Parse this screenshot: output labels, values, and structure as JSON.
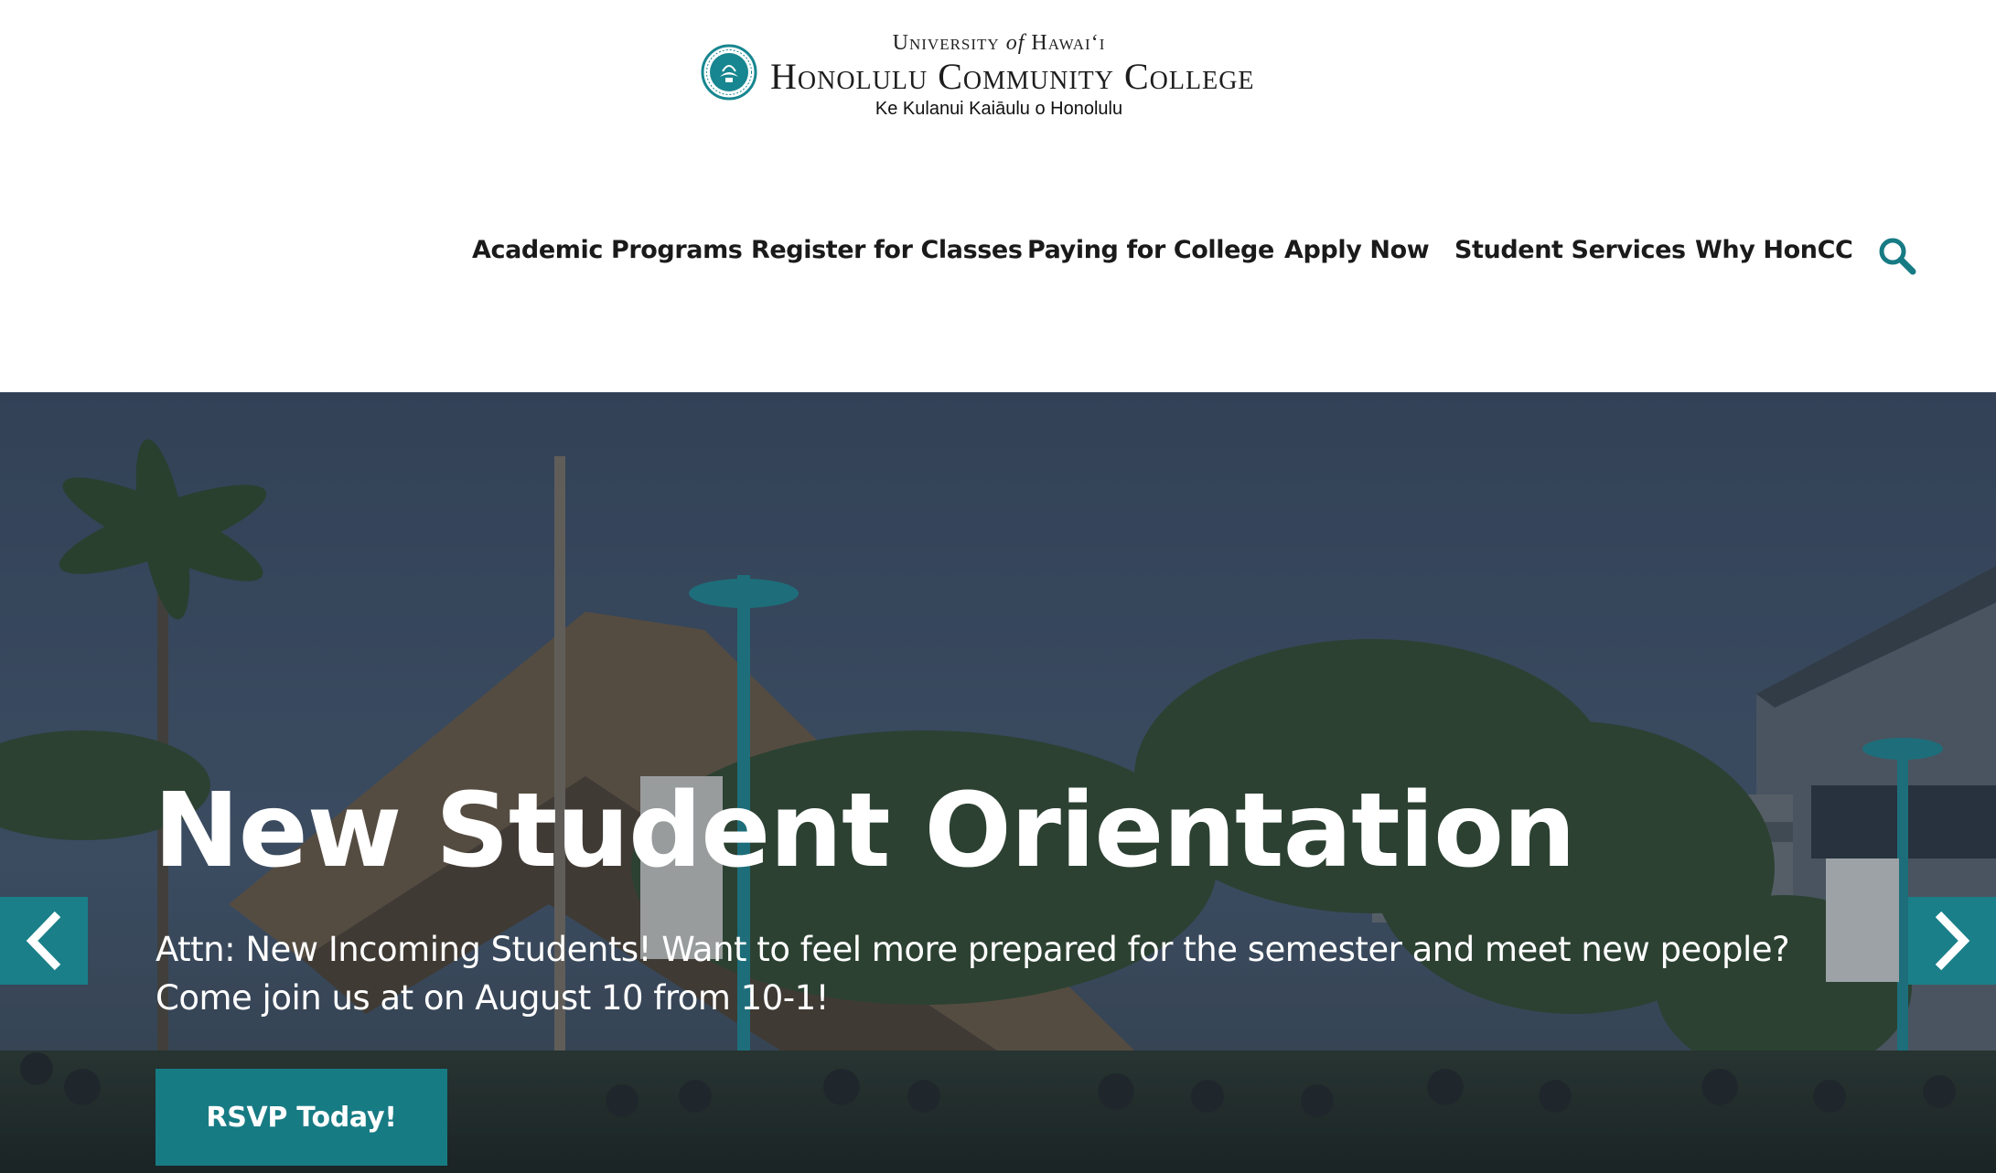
{
  "header": {
    "logo": {
      "line1_part1": "University",
      "line1_part2": "of",
      "line1_part3": "Hawai‘i",
      "line2": "Honolulu Community College",
      "line3": "Ke Kulanui Kaiāulu o Honolulu"
    },
    "nav": [
      {
        "label": "Academic Programs"
      },
      {
        "label": "Register for Classes"
      },
      {
        "label": "Paying for College"
      },
      {
        "label": "Apply Now"
      },
      {
        "label": "Student Services"
      },
      {
        "label": "Why HonCC"
      }
    ],
    "search_icon": "search-icon"
  },
  "hero": {
    "title": "New Student Orientation",
    "text": "Attn: New Incoming Students! Want to feel more prepared for the semester and meet new people? Come join us at on August 10 from 10-1!",
    "cta_label": "RSVP Today!",
    "prev_icon": "chevron-left-icon",
    "next_icon": "chevron-right-icon"
  },
  "colors": {
    "accent": "#177b84",
    "overlay": "#2a3548",
    "text_dark": "#1a1a1a"
  }
}
